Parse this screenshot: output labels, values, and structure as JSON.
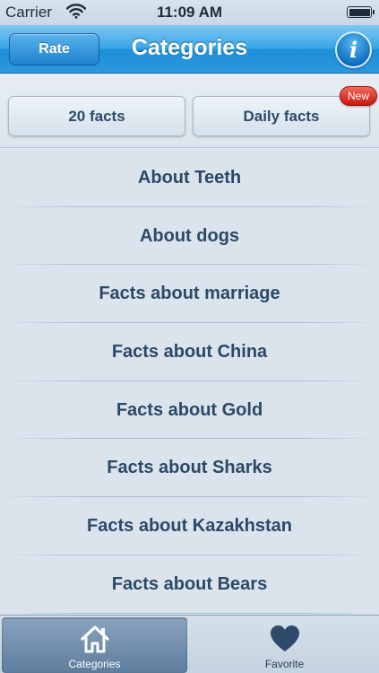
{
  "status_bar": {
    "carrier": "Carrier",
    "time": "11:09 AM",
    "wifi_icon": "wifi-icon",
    "battery_icon": "battery-icon"
  },
  "nav_bar": {
    "rate_label": "Rate",
    "title": "Categories",
    "info_label": "i"
  },
  "top_buttons": {
    "left_label": "20 facts",
    "right_label": "Daily facts",
    "badge": "New"
  },
  "categories": [
    "About Teeth",
    "About dogs",
    "Facts about marriage",
    "Facts about China",
    "Facts about Gold",
    "Facts about Sharks",
    "Facts about Kazakhstan",
    "Facts about Bears"
  ],
  "tab_bar": {
    "tabs": [
      {
        "label": "Categories",
        "icon": "home-icon",
        "active": true
      },
      {
        "label": "Favorite",
        "icon": "heart-icon",
        "active": false
      }
    ]
  },
  "colors": {
    "nav_blue": "#2a98dd",
    "badge_red": "#c8170d",
    "list_text": "#2b4867"
  }
}
